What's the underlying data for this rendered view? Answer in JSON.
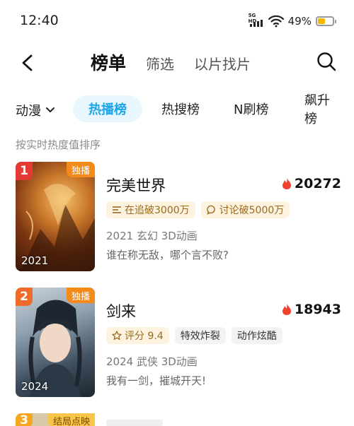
{
  "status_bar": {
    "time": "12:40",
    "network_label": "5G HD",
    "battery_percent": "49%",
    "battery_level": 0.49,
    "icons": [
      "signal-icon",
      "wifi-icon",
      "battery-icon"
    ]
  },
  "header": {
    "tabs": [
      {
        "label": "榜单",
        "active": true
      },
      {
        "label": "筛选",
        "active": false
      },
      {
        "label": "以片找片",
        "active": false
      }
    ],
    "icons": [
      "back-arrow-icon",
      "search-icon"
    ]
  },
  "filters": {
    "category": "动漫",
    "chips": [
      {
        "label": "热播榜",
        "active": true
      },
      {
        "label": "热搜榜",
        "active": false
      },
      {
        "label": "N刷榜",
        "active": false
      },
      {
        "label": "飙升榜",
        "active": false
      }
    ]
  },
  "hint": "按实时热度值排序",
  "items": [
    {
      "rank": "1",
      "badge": "独播",
      "year": "2021",
      "title": "完美世界",
      "heat": "20272",
      "tags": [
        {
          "text": "在追破3000万",
          "icon": "list-icon",
          "style": "gold"
        },
        {
          "text": "讨论破5000万",
          "icon": "chat-icon",
          "style": "gold"
        }
      ],
      "meta": "2021 玄幻 3D动画",
      "desc": "谁在称无敌，哪个言不败?"
    },
    {
      "rank": "2",
      "badge": "独播",
      "year": "2024",
      "title": "剑来",
      "heat": "18943",
      "tags": [
        {
          "text": "评分 9.4",
          "icon": "star-icon",
          "style": "gold"
        },
        {
          "text": "特效炸裂",
          "icon": "",
          "style": "gray"
        },
        {
          "text": "动作炫酷",
          "icon": "",
          "style": "gray"
        }
      ],
      "meta": "2024 武侠 3D动画",
      "desc": "我有一剑，摧城开天!"
    },
    {
      "rank": "3",
      "badge": "结局点映"
    }
  ],
  "colors": {
    "accent": "#1ba6e8",
    "accent_bg": "#e8f6fd",
    "rank_1": "#e53935",
    "rank_2": "#f06a2a",
    "rank_3": "#f5a623",
    "exclusive_badge": "#f48a1a",
    "heat_flame": "#f0412f",
    "gold_tag_bg": "#fdf3e0",
    "battery": "#f5b800"
  }
}
